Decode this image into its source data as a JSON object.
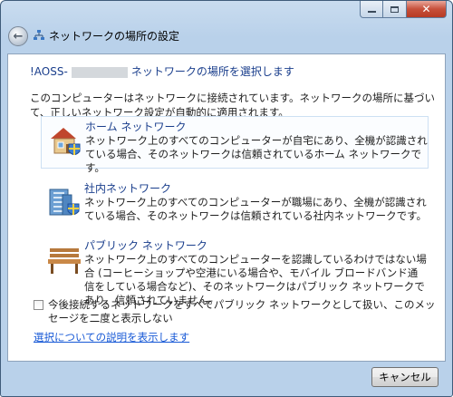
{
  "window": {
    "title": "ネットワークの場所の設定"
  },
  "content": {
    "heading_prefix": "!AOSS-",
    "heading_suffix": "ネットワークの場所を選択します",
    "intro": "このコンピューターはネットワークに接続されています。ネットワークの場所に基づいて、正しいネットワーク設定が自動的に適用されます。",
    "options": [
      {
        "title": "ホーム ネットワーク",
        "description": "ネットワーク上のすべてのコンピューターが自宅にあり、全機が認識されている場合、そのネットワークは信頼されているホーム ネットワークです。",
        "icon": "home-network-icon"
      },
      {
        "title": "社内ネットワーク",
        "description": "ネットワーク上のすべてのコンピューターが職場にあり、全機が認識されている場合、そのネットワークは信頼されている社内ネットワークです。",
        "icon": "work-network-icon"
      },
      {
        "title": "パブリック ネットワーク",
        "description": "ネットワーク上のすべてのコンピューターを認識しているわけではない場合 (コーヒーショップや空港にいる場合や、モバイル ブロードバンド通信をしている場合など)、そのネットワークはパブリック ネットワークであり、信頼されていません。",
        "icon": "public-network-icon"
      }
    ],
    "checkbox_label": "今後接続するネットワークをすべてパブリック ネットワークとして扱い、このメッセージを二度と表示しない",
    "checkbox_checked": false,
    "help_link": "選択についての説明を表示します"
  },
  "footer": {
    "cancel_label": "キャンセル"
  }
}
